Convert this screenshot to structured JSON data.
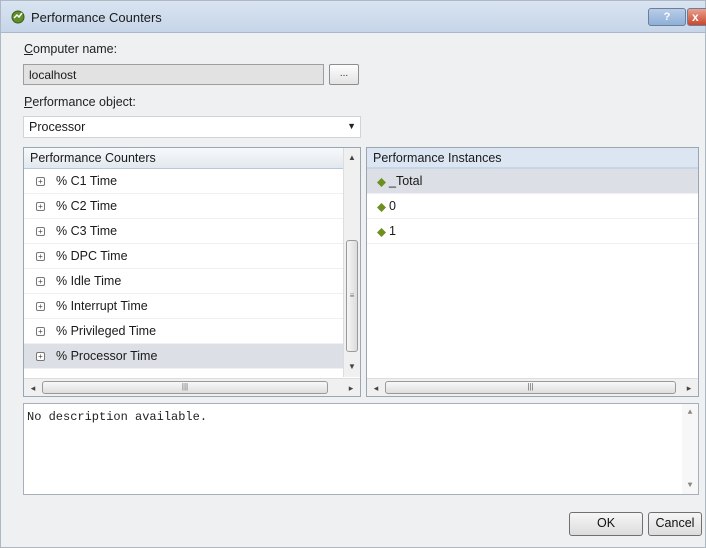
{
  "window": {
    "title": "Performance Counters",
    "help_label": "?",
    "close_label": "x"
  },
  "computer": {
    "label_accel": "C",
    "label_rest": "omputer name:",
    "value": "localhost",
    "browse_label": "..."
  },
  "object": {
    "label_accel": "P",
    "label_rest": "erformance object:",
    "value": "Processor"
  },
  "counters": {
    "header": "Performance Counters",
    "items": [
      {
        "label": "% C1 Time"
      },
      {
        "label": "% C2 Time"
      },
      {
        "label": "% C3 Time"
      },
      {
        "label": "% DPC Time"
      },
      {
        "label": "% Idle Time"
      },
      {
        "label": "% Interrupt Time"
      },
      {
        "label": "% Privileged Time"
      },
      {
        "label": "% Processor Time"
      }
    ],
    "selected_index": 7
  },
  "instances": {
    "header": "Performance Instances",
    "items": [
      {
        "label": "_Total"
      },
      {
        "label": "0"
      },
      {
        "label": "1"
      }
    ],
    "selected_index": 0
  },
  "description": "No description available.",
  "buttons": {
    "ok": "OK",
    "cancel": "Cancel"
  },
  "colors": {
    "titlebar": "#c6d5e8",
    "selection": "#dcdfe5",
    "instance_icon": "#6c8f1e"
  }
}
